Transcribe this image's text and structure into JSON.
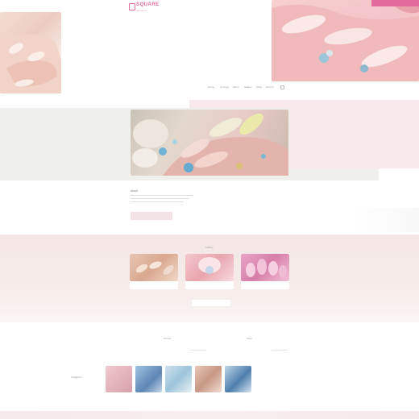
{
  "header": {
    "logo_text": "SQUARE",
    "logo_sub": "nail salon",
    "tagline": "",
    "reserve_button": "",
    "nav": [
      "Home",
      "Concept",
      "Menu",
      "Gallery",
      "Shop",
      "Recruit",
      "",
      ""
    ]
  },
  "about": {
    "title": "About",
    "button": ""
  },
  "gallery": {
    "title": "Gallery",
    "items": [
      {
        "caption": ""
      },
      {
        "caption": ""
      },
      {
        "caption": ""
      }
    ],
    "more_button": ""
  },
  "info": {
    "left_title": "Access",
    "left_value": "",
    "right_title": "Shop",
    "right_value": "",
    "instagram_label": "Instagram",
    "instagram_sub": ""
  },
  "colors": {
    "accent": "#e46a9c",
    "pink_bg": "#f8e9ec",
    "gray_bg": "#efefeb",
    "hero_pink": "#f3c4c8"
  }
}
